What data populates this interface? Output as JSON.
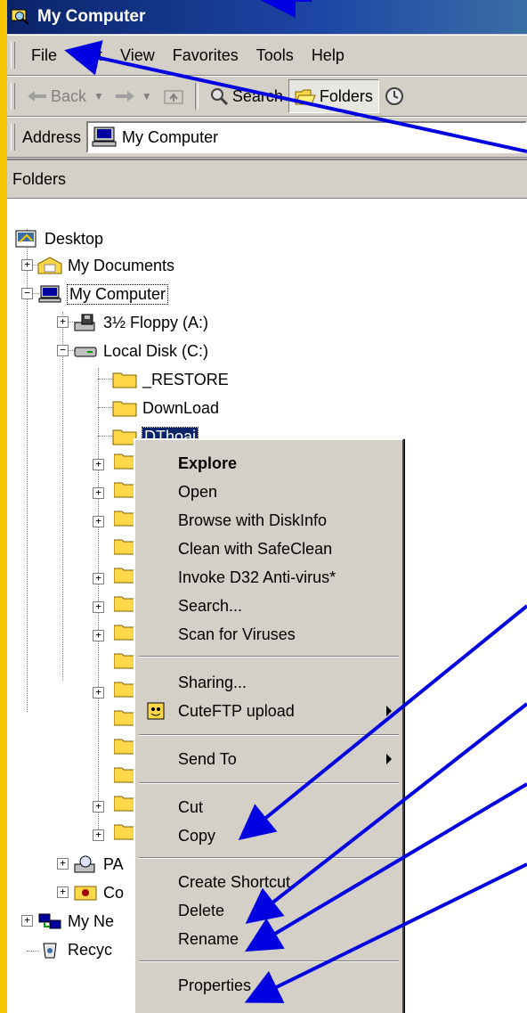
{
  "window": {
    "title": "My Computer"
  },
  "menubar": [
    "File",
    "Edit",
    "View",
    "Favorites",
    "Tools",
    "Help"
  ],
  "toolbar": {
    "back": "Back",
    "search": "Search",
    "folders": "Folders"
  },
  "address": {
    "label": "Address",
    "value": "My Computer"
  },
  "panel": {
    "header": "Folders"
  },
  "tree": {
    "desktop": "Desktop",
    "my_documents": "My Documents",
    "my_computer": "My Computer",
    "floppy": "3½ Floppy (A:)",
    "local_disk": "Local Disk (C:)",
    "restore": "_RESTORE",
    "download": "DownLoad",
    "dthoai": "DThoai",
    "pa_trunc": "PA",
    "co_trunc": "Co",
    "network_trunc": "My Ne",
    "recycle_trunc": "Recyc"
  },
  "context_menu": {
    "explore": "Explore",
    "open": "Open",
    "browse": "Browse with DiskInfo",
    "clean": "Clean with SafeClean",
    "invoke": "Invoke D32 Anti-virus*",
    "search": "Search...",
    "scan": "Scan for Viruses",
    "sharing": "Sharing...",
    "cuteftp": "CuteFTP upload",
    "sendto": "Send To",
    "cut": "Cut",
    "copy": "Copy",
    "shortcut": "Create Shortcut",
    "delete": "Delete",
    "rename": "Rename",
    "properties": "Properties"
  },
  "colors": {
    "selection": "#0a246a",
    "annotation_arrow": "#0000e0",
    "background": "#f7c600"
  }
}
